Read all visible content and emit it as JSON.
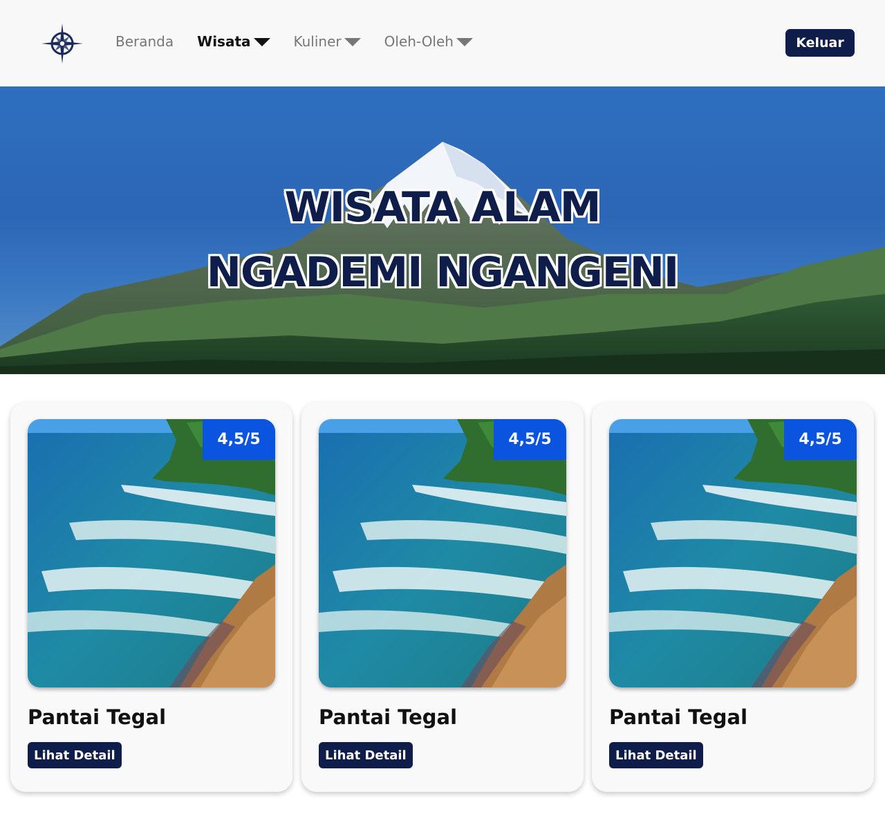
{
  "nav": {
    "items": [
      {
        "label": "Beranda",
        "dropdown": false,
        "active": false
      },
      {
        "label": "Wisata",
        "dropdown": true,
        "active": true
      },
      {
        "label": "Kuliner",
        "dropdown": true,
        "active": false
      },
      {
        "label": "Oleh-Oleh",
        "dropdown": true,
        "active": false
      }
    ],
    "logout_label": "Keluar"
  },
  "hero": {
    "title_line1": "WISATA ALAM",
    "title_line2": "NGADEMI NGANGENI"
  },
  "cards": [
    {
      "title": "Pantai Tegal",
      "rating": "4,5/5",
      "button": "Lihat Detail"
    },
    {
      "title": "Pantai Tegal",
      "rating": "4,5/5",
      "button": "Lihat Detail"
    },
    {
      "title": "Pantai Tegal",
      "rating": "4,5/5",
      "button": "Lihat Detail"
    }
  ],
  "colors": {
    "primary": "#0f1d4a",
    "badge": "#0b54e0",
    "navbar_bg": "#f8f8f8",
    "card_bg": "#f9f9f9"
  },
  "icons": {
    "logo": "compass-logo-icon",
    "dropdown": "caret-down-icon"
  }
}
